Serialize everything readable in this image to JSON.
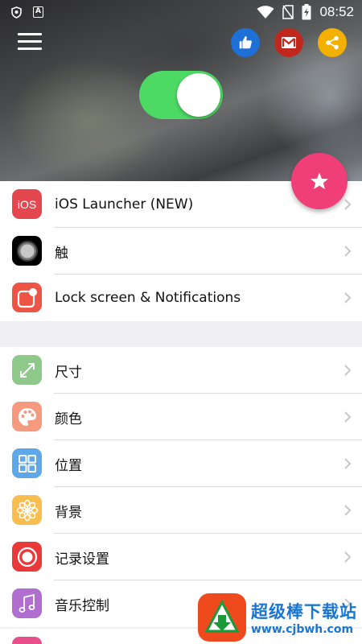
{
  "statusbar": {
    "time": "08:52",
    "notification_letter": "A"
  },
  "header": {
    "toggle_on": true,
    "buttons": [
      {
        "name": "like",
        "icon": "thumbs-up-icon",
        "color": "#1e6fd6"
      },
      {
        "name": "mail",
        "icon": "gmail-icon",
        "color": "#c0281e"
      },
      {
        "name": "share",
        "icon": "share-icon",
        "color": "#f4b000"
      }
    ]
  },
  "fab": {
    "icon": "star-icon",
    "color": "#f03e78"
  },
  "group_a": [
    {
      "label": "iOS Launcher (NEW)",
      "icon": "ios-icon",
      "icon_text": "iOS",
      "color": "#e5474f"
    },
    {
      "label": "触",
      "icon": "assistive-touch-icon",
      "color": "#000000"
    },
    {
      "label": "Lock screen & Notifications",
      "icon": "notification-badge-icon",
      "color": "#ee5445"
    }
  ],
  "group_b": [
    {
      "label": "尺寸",
      "icon": "resize-arrows-icon",
      "color": "#8fc98a"
    },
    {
      "label": "颜色",
      "icon": "palette-icon",
      "color": "#f59a7e"
    },
    {
      "label": "位置",
      "icon": "grid-icon",
      "color": "#5ea8ea"
    },
    {
      "label": "背景",
      "icon": "flower-icon",
      "color": "#f7bd4e"
    },
    {
      "label": "记录设置",
      "icon": "record-icon",
      "color": "#e9393a"
    },
    {
      "label": "音乐控制",
      "icon": "music-note-icon",
      "color": "#b06ed1"
    }
  ],
  "watermark": {
    "title": "超级棒下载站",
    "url": "www.cjbwh.com"
  }
}
